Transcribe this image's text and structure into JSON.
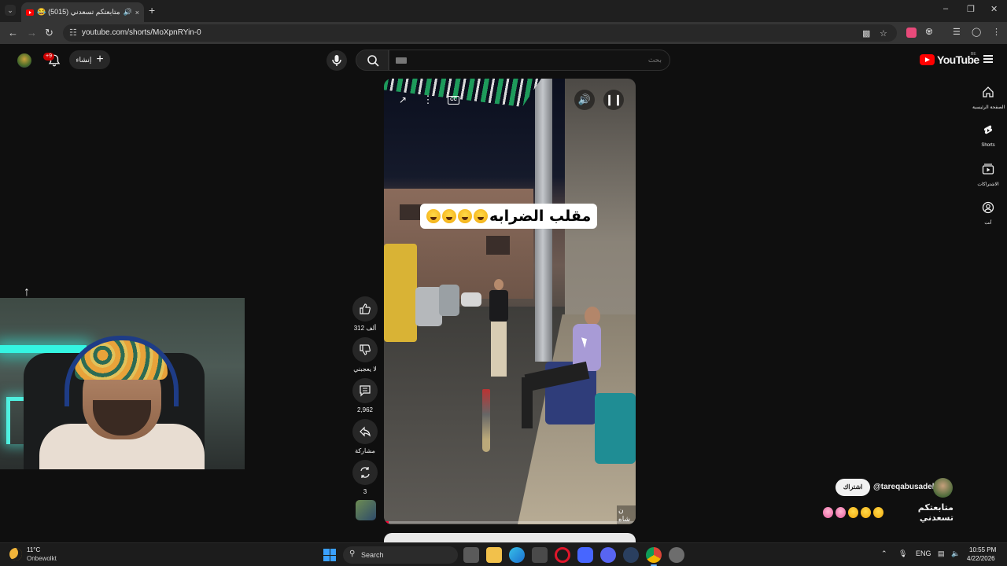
{
  "browser": {
    "tab": {
      "title": "متابعتكم تسعدني (5015) 😂 !",
      "speaker_glyph": "🔊",
      "close_glyph": "×"
    },
    "new_tab_glyph": "+",
    "url": "youtube.com/shorts/MoXpnRYin-0",
    "window_controls": {
      "minimize": "–",
      "restore": "❐",
      "close": "✕"
    }
  },
  "youtube": {
    "create_label": "إنشاء",
    "notifications_badge": "+9",
    "search_placeholder": "بحث",
    "logo_text": "YouTube",
    "region_code": "BE",
    "guide": [
      {
        "label": "الصفحة الرئيسية",
        "icon": "home-icon"
      },
      {
        "label": "Shorts",
        "icon": "shorts-icon"
      },
      {
        "label": "الاشتراكات",
        "icon": "subscriptions-icon"
      },
      {
        "label": "أنت",
        "icon": "you-icon"
      }
    ]
  },
  "short": {
    "caption": "مقلب الضرابه",
    "watermark": "ن شاه",
    "progress": 0.02,
    "actions": {
      "likes": "312 ألف",
      "dislike_label": "لا يعجبني",
      "comments": "2,962",
      "share_label": "مشاركة",
      "remix_count": "3"
    },
    "channel": "@tareqabusadeh",
    "subscribe_label": "اشتراك",
    "title": "متابعتكم تسعدني"
  },
  "taskbar": {
    "temperature": "11°C",
    "weather": "Onbewolkt",
    "search_label": "Search",
    "language": "ENG",
    "time": "10:55 PM",
    "date": "4/22/2026",
    "apps": [
      "file-explorer",
      "edge",
      "store",
      "opera",
      "app-blue",
      "discord",
      "steam",
      "chrome",
      "settings"
    ]
  },
  "colors": {
    "accent_red": "#ff0000",
    "background": "#0f0f0f",
    "chip": "#272727"
  }
}
